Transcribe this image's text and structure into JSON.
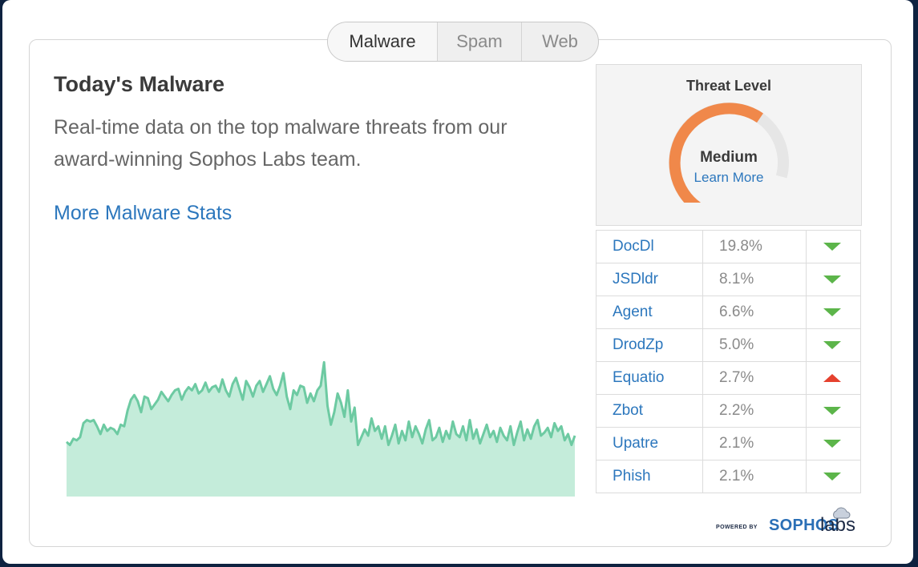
{
  "tabs": [
    {
      "label": "Malware",
      "active": true
    },
    {
      "label": "Spam",
      "active": false
    },
    {
      "label": "Web",
      "active": false
    }
  ],
  "main": {
    "title": "Today's Malware",
    "description": "Real-time data on the top malware threats from our award-winning Sophos Labs team.",
    "stats_link": "More Malware Stats"
  },
  "threat_level": {
    "title": "Threat Level",
    "level": "Medium",
    "learn_more": "Learn More",
    "gauge_fraction": 0.72,
    "colors": {
      "fill": "#f0884a",
      "track": "#e6e6e6"
    }
  },
  "threats": [
    {
      "name": "DocDl",
      "percent": "19.8%",
      "trend": "down"
    },
    {
      "name": "JSDldr",
      "percent": "8.1%",
      "trend": "down"
    },
    {
      "name": "Agent",
      "percent": "6.6%",
      "trend": "down"
    },
    {
      "name": "DrodZp",
      "percent": "5.0%",
      "trend": "down"
    },
    {
      "name": "Equatio",
      "percent": "2.7%",
      "trend": "up"
    },
    {
      "name": "Zbot",
      "percent": "2.2%",
      "trend": "down"
    },
    {
      "name": "Upatre",
      "percent": "2.1%",
      "trend": "down"
    },
    {
      "name": "Phish",
      "percent": "2.1%",
      "trend": "down"
    }
  ],
  "powered_by": {
    "prefix": "POWERED BY",
    "brand": "SOPHOS",
    "suffix": "labs"
  },
  "chart_data": {
    "type": "area",
    "title": "",
    "xlabel": "",
    "ylabel": "",
    "ylim": [
      0,
      100
    ],
    "grid": false,
    "colors": {
      "fill": "#c4ecda",
      "line": "#6dcaa2"
    },
    "values": [
      35,
      33,
      37,
      36,
      38,
      47,
      49,
      48,
      49,
      45,
      40,
      46,
      42,
      44,
      43,
      40,
      46,
      45,
      55,
      62,
      65,
      61,
      54,
      64,
      63,
      56,
      59,
      62,
      67,
      64,
      61,
      65,
      68,
      69,
      62,
      67,
      70,
      68,
      72,
      66,
      68,
      73,
      67,
      70,
      71,
      67,
      75,
      68,
      64,
      72,
      76,
      69,
      62,
      74,
      70,
      64,
      71,
      74,
      67,
      72,
      77,
      69,
      65,
      71,
      79,
      64,
      56,
      68,
      65,
      71,
      70,
      60,
      66,
      61,
      68,
      71,
      86,
      58,
      46,
      54,
      66,
      60,
      51,
      68,
      48,
      57,
      33,
      38,
      43,
      39,
      50,
      42,
      45,
      37,
      45,
      33,
      39,
      46,
      34,
      42,
      36,
      48,
      38,
      45,
      40,
      34,
      43,
      49,
      36,
      38,
      44,
      35,
      42,
      37,
      48,
      40,
      38,
      45,
      36,
      49,
      37,
      43,
      34,
      40,
      46,
      38,
      42,
      35,
      44,
      39,
      36,
      45,
      33,
      41,
      48,
      36,
      43,
      37,
      45,
      49,
      39,
      41,
      44,
      38,
      47,
      42,
      45,
      36,
      40,
      33,
      39
    ]
  }
}
